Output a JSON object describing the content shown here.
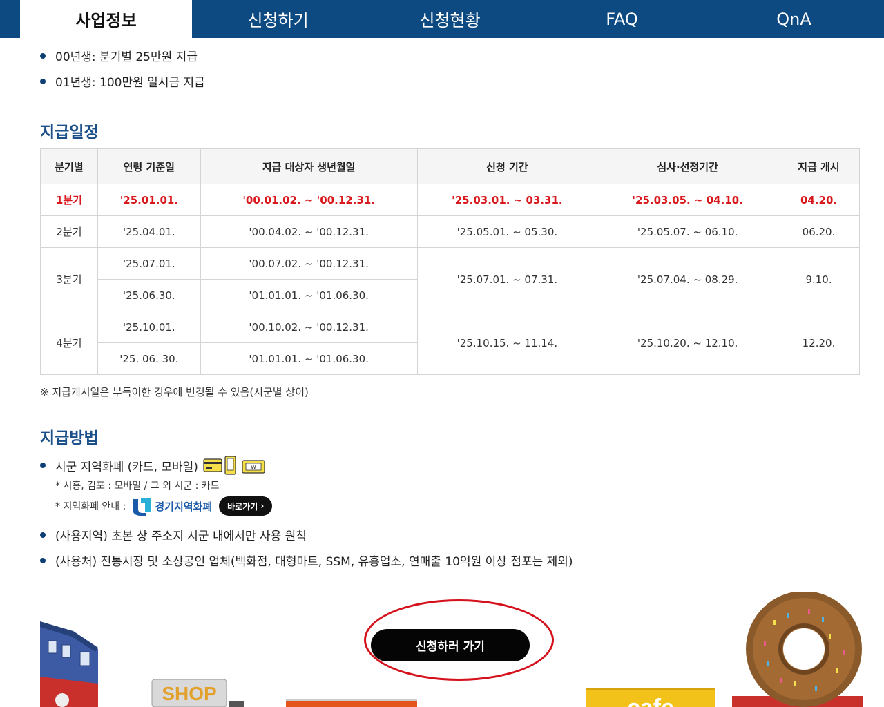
{
  "tabs": [
    {
      "label": "사업정보",
      "active": true
    },
    {
      "label": "신청하기",
      "active": false
    },
    {
      "label": "신청현황",
      "active": false
    },
    {
      "label": "FAQ",
      "active": false
    },
    {
      "label": "QnA",
      "active": false
    }
  ],
  "eligibility": [
    "00년생: 분기별 25만원 지급",
    "01년생: 100만원 일시금 지급"
  ],
  "schedule": {
    "title": "지급일정",
    "headers": [
      "분기별",
      "연령 기준일",
      "지급 대상자 생년월일",
      "신청 기간",
      "심사·선정기간",
      "지급 개시"
    ],
    "q1": {
      "quarter": "1분기",
      "base": "'25.01.01.",
      "birth": "'00.01.02. ~ '00.12.31.",
      "apply": "'25.03.01. ~ 03.31.",
      "review": "'25.03.05. ~ 04.10.",
      "pay": "04.20."
    },
    "q2": {
      "quarter": "2분기",
      "base": "'25.04.01.",
      "birth": "'00.04.02. ~ '00.12.31.",
      "apply": "'25.05.01. ~ 05.30.",
      "review": "'25.05.07. ~ 06.10.",
      "pay": "06.20."
    },
    "q3": {
      "quarter": "3분기",
      "base_a": "'25.07.01.",
      "birth_a": "'00.07.02. ~ '00.12.31.",
      "base_b": "'25.06.30.",
      "birth_b": "'01.01.01. ~ '01.06.30.",
      "apply": "'25.07.01. ~ 07.31.",
      "review": "'25.07.04. ~ 08.29.",
      "pay": "9.10."
    },
    "q4": {
      "quarter": "4분기",
      "base_a": "'25.10.01.",
      "birth_a": "'00.10.02. ~ '00.12.31.",
      "base_b": "'25. 06. 30.",
      "birth_b": "'01.01.01. ~ '01.06.30.",
      "apply": "'25.10.15. ~ 11.14.",
      "review": "'25.10.20. ~ 12.10.",
      "pay": "12.20."
    },
    "note": "※ 지급개시일은 부득이한 경우에 변경될 수 있음(시군별 상이)"
  },
  "method": {
    "title": "지급방법",
    "item1": "시군 지역화폐 (카드, 모바일)",
    "sub1": "* 시흥, 김포 : 모바일 / 그 외 시군 : 카드",
    "sub2": "* 지역화폐 안내 :",
    "brand": "경기지역화폐",
    "go_label": "바로가기",
    "item2": "(사용지역) 초본 상 주소지 시군 내에서만 사용 원칙",
    "item3": "(사용처) 전통시장 및 소상공인 업체(백화점, 대형마트, SSM, 유흥업소, 연매출 10억원 이상 점포는 제외)"
  },
  "cta": {
    "label": "신청하러 가기"
  },
  "illustrations": {
    "shop_sign": "SHOP",
    "cafe_sign": "cafe"
  },
  "colors": {
    "nav": "#0d4a82",
    "heading": "#1a4f8a",
    "highlight": "#d8191e",
    "button": "#050505"
  }
}
